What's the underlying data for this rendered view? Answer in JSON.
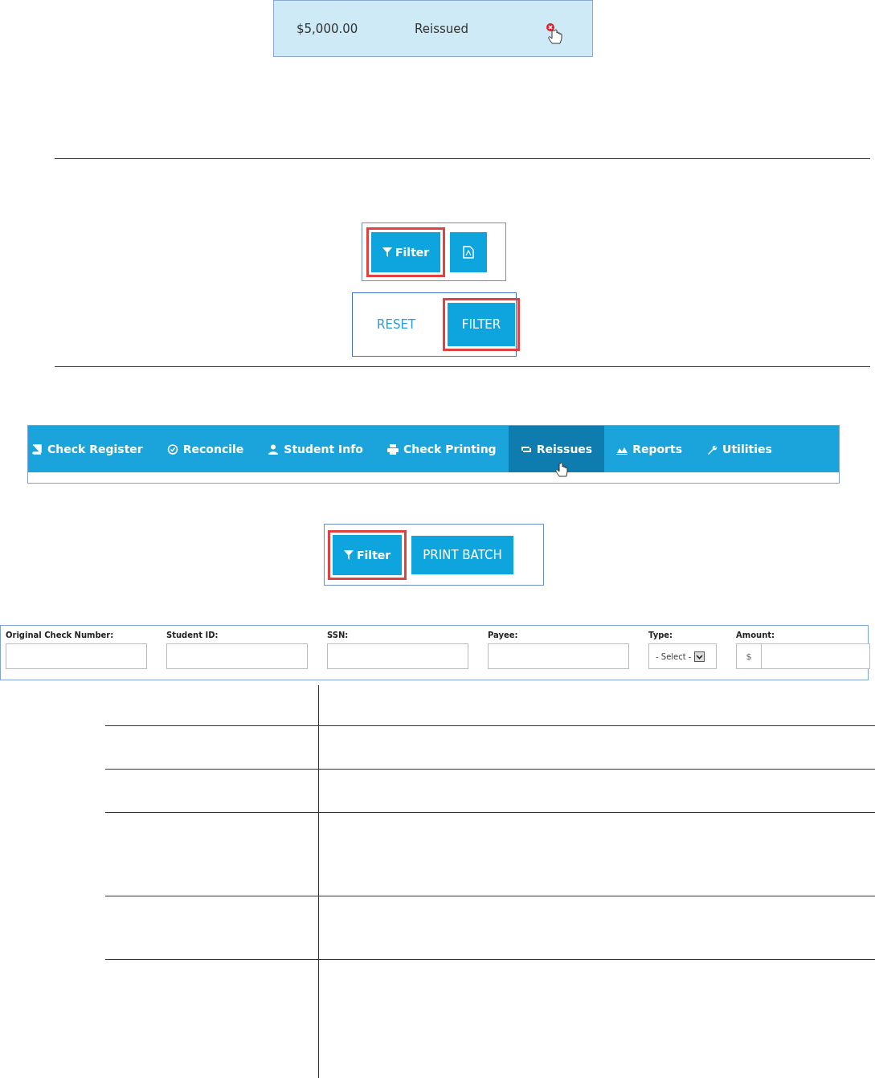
{
  "reissue_row": {
    "amount": "$5,000.00",
    "status": "Reissued"
  },
  "report_toolbar": {
    "buttons": [
      {
        "kind": "filter",
        "label": "Filter",
        "highlighted": true
      },
      {
        "kind": "pdf",
        "highlighted": false
      }
    ]
  },
  "filter_actions": {
    "buttons": [
      {
        "kind": "link",
        "label": "RESET",
        "highlighted": false
      },
      {
        "kind": "primary",
        "label": "FILTER",
        "highlighted": true
      }
    ]
  },
  "nav_tabs": [
    {
      "label": "Check Register",
      "selected": false
    },
    {
      "label": "Reconcile",
      "selected": false
    },
    {
      "label": "Student Info",
      "selected": false
    },
    {
      "label": "Check Printing",
      "selected": false
    },
    {
      "label": "Reissues",
      "selected": true
    },
    {
      "label": "Reports",
      "selected": false
    },
    {
      "label": "Utilities",
      "selected": false
    }
  ],
  "batch_toolbar": {
    "buttons": [
      {
        "kind": "filter",
        "label": "Filter",
        "highlighted": true
      },
      {
        "kind": "primary",
        "label": "PRINT BATCH",
        "highlighted": false
      }
    ]
  },
  "filter_form": {
    "fields": [
      {
        "kind": "text",
        "label": "Original Check Number:"
      },
      {
        "kind": "text",
        "label": "Student ID:"
      },
      {
        "kind": "text",
        "label": "SSN:"
      },
      {
        "kind": "text",
        "label": "Payee:"
      },
      {
        "kind": "select",
        "label": "Type:",
        "value": "- Select -"
      },
      {
        "kind": "money",
        "label": "Amount:",
        "prefix": "$"
      }
    ]
  }
}
